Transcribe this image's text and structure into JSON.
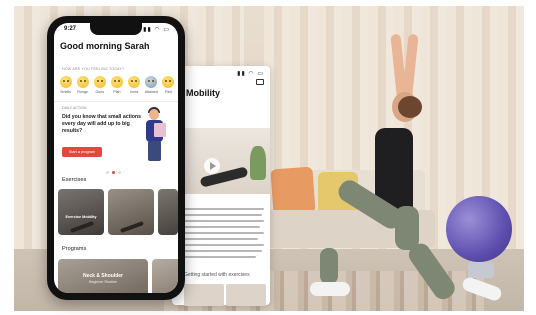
{
  "front_phone": {
    "status_time": "9:27",
    "status_icons": "▮▮ ◠ ▭",
    "greeting": "Good morning Sarah",
    "mood_question": "HOW ARE YOU FEELING TODAY?",
    "moods": [
      {
        "label": "Smells",
        "icon": "sad-face-icon"
      },
      {
        "label": "Ronge",
        "icon": "angry-face-icon"
      },
      {
        "label": "Guns",
        "icon": "neutral-face-icon"
      },
      {
        "label": "Plan",
        "icon": "smile-face-icon"
      },
      {
        "label": "Inma",
        "icon": "happy-face-icon"
      },
      {
        "label": "Attained",
        "icon": "robot-face-icon"
      },
      {
        "label": "Red",
        "icon": "grin-face-icon"
      }
    ],
    "daily_card": {
      "tag": "DAILY ACTION",
      "text": "Did you know that small actions every day will add up to big results?",
      "button_label": "Start a program"
    },
    "exercises_heading": "Exercises",
    "exercises": [
      {
        "label": "Exercise Mobility"
      },
      {
        "label": ""
      },
      {
        "label": ""
      }
    ],
    "programs_heading": "Programs",
    "program_card": {
      "title": "Neck & Shoulder",
      "subtitle": "Beginner Routine"
    }
  },
  "back_phone": {
    "status_icons": "▮▮ ◠ ▭",
    "title": "al Mobility",
    "sub_label": "Getting started with exercises"
  },
  "colors": {
    "accent": "#e2483d",
    "phone_frame": "#111111"
  }
}
